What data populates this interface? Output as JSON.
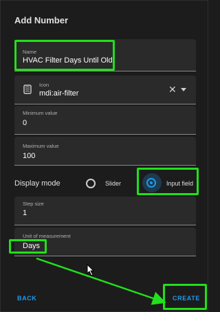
{
  "dialog": {
    "title": "Add Number",
    "name": {
      "label": "Name",
      "value": "HVAC Filter Days Until Old"
    },
    "icon": {
      "label": "Icon",
      "value": "mdi:air-filter"
    },
    "minimum": {
      "label": "Minimum value",
      "value": "0"
    },
    "maximum": {
      "label": "Maximum value",
      "value": "100"
    },
    "display_mode": {
      "label": "Display mode",
      "options": [
        "Slider",
        "Input field"
      ],
      "selected": "Input field"
    },
    "step": {
      "label": "Step size",
      "value": "1"
    },
    "unit": {
      "label": "Unit of measurement",
      "value": "Days"
    },
    "buttons": {
      "back": "BACK",
      "create": "CREATE"
    }
  },
  "colors": {
    "highlight": "#22e01a",
    "accent": "#1d9bf0",
    "background": "#1c1c1c",
    "field": "#2a2a2a"
  },
  "icons": [
    "air-filter-icon",
    "clear-icon",
    "dropdown-icon",
    "mouse-cursor-icon"
  ]
}
